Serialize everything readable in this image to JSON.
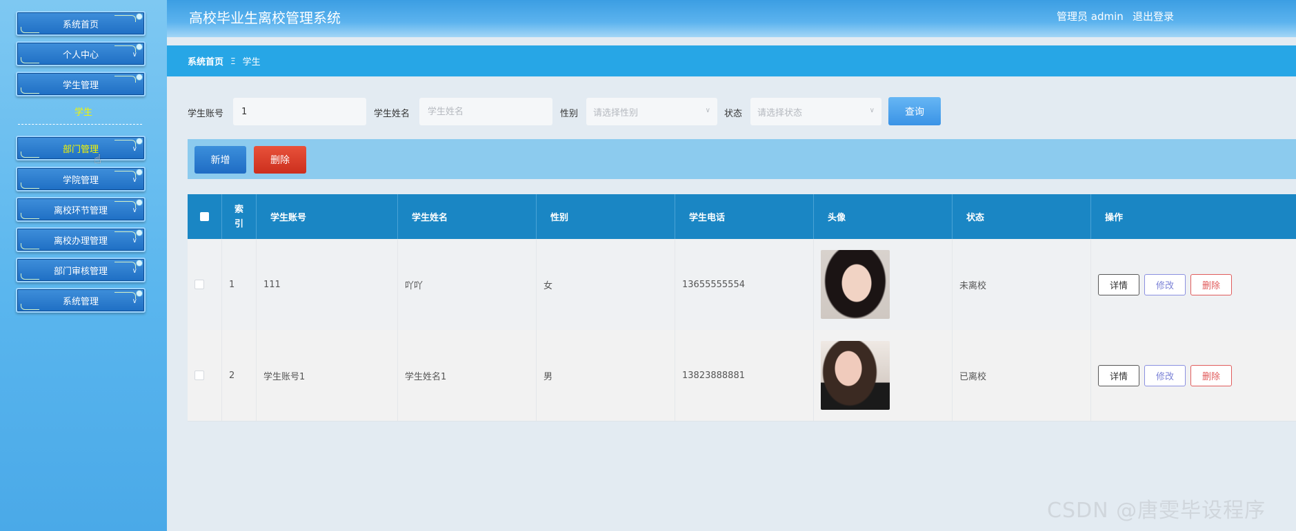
{
  "sidebar": {
    "items": [
      {
        "label": "系统首页"
      },
      {
        "label": "个人中心"
      },
      {
        "label": "学生管理"
      },
      {
        "label": "部门管理"
      },
      {
        "label": "学院管理"
      },
      {
        "label": "离校环节管理"
      },
      {
        "label": "离校办理管理"
      },
      {
        "label": "部门审核管理"
      },
      {
        "label": "系统管理"
      }
    ],
    "submenu": {
      "label": "学生"
    }
  },
  "header": {
    "title": "高校毕业生离校管理系统",
    "user": "管理员 admin",
    "logout": "退出登录"
  },
  "breadcrumb": {
    "home": "系统首页",
    "separator": "Ξ",
    "current": "学生"
  },
  "search": {
    "account_label": "学生账号",
    "account_value": "1",
    "name_label": "学生姓名",
    "name_placeholder": "学生姓名",
    "gender_label": "性别",
    "gender_placeholder": "请选择性别",
    "status_label": "状态",
    "status_placeholder": "请选择状态",
    "query_button": "查询"
  },
  "actions": {
    "add": "新增",
    "delete": "删除"
  },
  "table": {
    "headers": {
      "index_line1": "索",
      "index_line2": "引",
      "account": "学生账号",
      "name": "学生姓名",
      "gender": "性别",
      "phone": "学生电话",
      "avatar": "头像",
      "status": "状态",
      "ops": "操作"
    },
    "rows": [
      {
        "index": "1",
        "account": "111",
        "name": "吖吖",
        "gender": "女",
        "phone": "13655555554",
        "status": "未离校"
      },
      {
        "index": "2",
        "account": "学生账号1",
        "name": "学生姓名1",
        "gender": "男",
        "phone": "13823888881",
        "status": "已离校"
      }
    ],
    "op_labels": {
      "detail": "详情",
      "edit": "修改",
      "delete": "删除"
    }
  },
  "watermark": "CSDN @唐雯毕设程序"
}
